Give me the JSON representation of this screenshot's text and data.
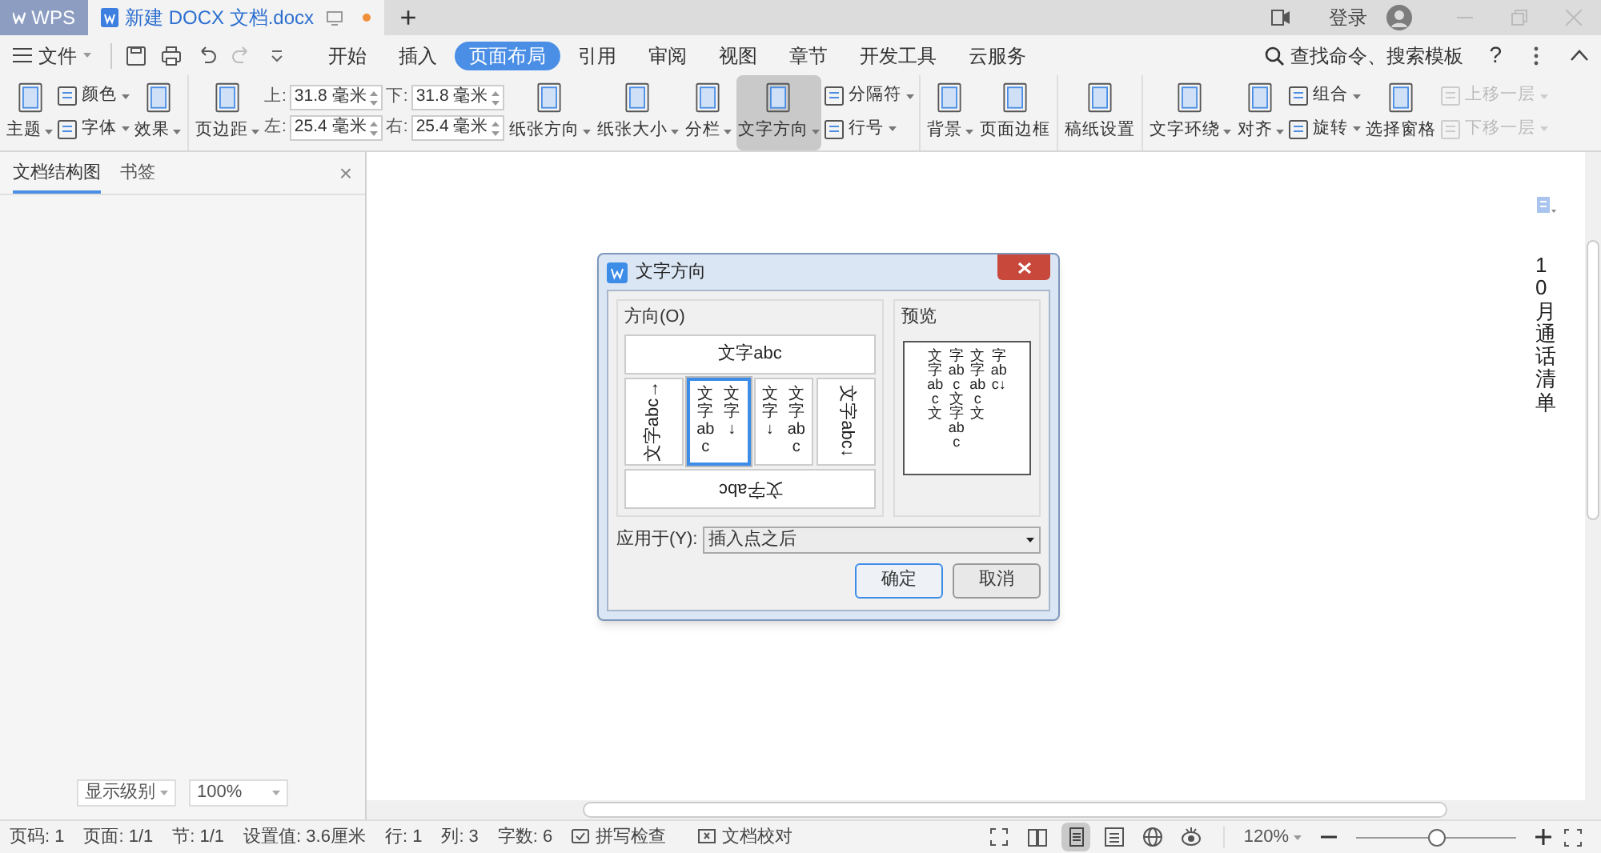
{
  "titlebar": {
    "app": "WPS",
    "document_tab": "新建 DOCX 文档.docx",
    "new_tab": "+",
    "login": "登录"
  },
  "menu": {
    "file": "文件",
    "tabs": [
      {
        "label": "开始",
        "selected": false
      },
      {
        "label": "插入",
        "selected": false
      },
      {
        "label": "页面布局",
        "selected": true
      },
      {
        "label": "引用",
        "selected": false
      },
      {
        "label": "审阅",
        "selected": false
      },
      {
        "label": "视图",
        "selected": false
      },
      {
        "label": "章节",
        "selected": false
      },
      {
        "label": "开发工具",
        "selected": false
      },
      {
        "label": "云服务",
        "selected": false
      }
    ],
    "search": "查找命令、搜索模板",
    "help": "?"
  },
  "ribbon": [
    [
      {
        "kind": "large",
        "label": "主题",
        "dropdown": true,
        "pressed": false
      },
      {
        "kind": "pair",
        "items": [
          {
            "label": "颜色",
            "dropdown": true,
            "disabled": false
          },
          {
            "label": "字体",
            "dropdown": true,
            "disabled": false
          }
        ]
      },
      {
        "kind": "large",
        "label": "效果",
        "dropdown": true,
        "pressed": false
      }
    ],
    [
      {
        "kind": "large",
        "label": "页边距",
        "dropdown": true,
        "pressed": false
      },
      {
        "kind": "spin",
        "items": [
          {
            "label": "上:",
            "value": "31.8 毫米"
          },
          {
            "label": "左:",
            "value": "25.4 毫米"
          }
        ]
      },
      {
        "kind": "spin",
        "items": [
          {
            "label": "下:",
            "value": "31.8 毫米"
          },
          {
            "label": "右:",
            "value": "25.4 毫米"
          }
        ]
      },
      {
        "kind": "large",
        "label": "纸张方向",
        "dropdown": true,
        "pressed": false
      },
      {
        "kind": "large",
        "label": "纸张大小",
        "dropdown": true,
        "pressed": false
      },
      {
        "kind": "large",
        "label": "分栏",
        "dropdown": true,
        "pressed": false
      },
      {
        "kind": "large",
        "label": "文字方向",
        "dropdown": true,
        "pressed": true
      },
      {
        "kind": "pair",
        "items": [
          {
            "label": "分隔符",
            "dropdown": true,
            "disabled": false
          },
          {
            "label": "行号",
            "dropdown": true,
            "disabled": false
          }
        ]
      }
    ],
    [
      {
        "kind": "large",
        "label": "背景",
        "dropdown": true,
        "pressed": false
      },
      {
        "kind": "large",
        "label": "页面边框",
        "dropdown": false,
        "pressed": false
      }
    ],
    [
      {
        "kind": "large",
        "label": "稿纸设置",
        "dropdown": false,
        "pressed": false
      }
    ],
    [
      {
        "kind": "large",
        "label": "文字环绕",
        "dropdown": true,
        "pressed": false
      },
      {
        "kind": "large",
        "label": "对齐",
        "dropdown": true,
        "pressed": false
      },
      {
        "kind": "pair",
        "items": [
          {
            "label": "组合",
            "dropdown": true,
            "disabled": false
          },
          {
            "label": "旋转",
            "dropdown": true,
            "disabled": false
          }
        ]
      },
      {
        "kind": "large",
        "label": "选择窗格",
        "dropdown": false,
        "pressed": false
      },
      {
        "kind": "pair",
        "items": [
          {
            "label": "上移一层",
            "dropdown": true,
            "disabled": true
          },
          {
            "label": "下移一层",
            "dropdown": true,
            "disabled": true
          }
        ]
      }
    ]
  ],
  "sidebar": {
    "tabs": [
      {
        "label": "文档结构图",
        "selected": true
      },
      {
        "label": "书签",
        "selected": false
      }
    ],
    "close": "×",
    "level_select": "显示级别",
    "zoom_select": "100%"
  },
  "page": {
    "text": "10 月通话清单"
  },
  "dialog": {
    "title": "文字方向",
    "direction_group": "方向(O)",
    "preview_group": "预览",
    "options": [
      {
        "kind": "horizontal",
        "lines": [
          "文字abc"
        ],
        "selected": false
      },
      {
        "kind": "rotate-ccw",
        "lines": [
          "文字abc→"
        ],
        "selected": false
      },
      {
        "kind": "columns",
        "lines": [
          "文字abc",
          "文字↓"
        ],
        "selected": true
      },
      {
        "kind": "columns",
        "lines": [
          "文字↓",
          "文字abc"
        ],
        "selected": false
      },
      {
        "kind": "rotate-cw",
        "lines": [
          "文字abc↓"
        ],
        "selected": false
      },
      {
        "kind": "rotate-180",
        "lines": [
          "文字abc"
        ],
        "selected": false
      }
    ],
    "preview_lines": [
      "文字abc文",
      "字abc文字abc",
      "文字abc文",
      "字abc↓"
    ],
    "apply_label": "应用于(Y):",
    "apply_value": "插入点之后",
    "ok": "确定",
    "cancel": "取消"
  },
  "status_bar": {
    "items": [
      "页码: 1",
      "页面: 1/1",
      "节: 1/1",
      "设置值: 3.6厘米",
      "行: 1",
      "列: 3",
      "字数: 6"
    ],
    "spell": "拼写检查",
    "proof": "文档校对",
    "zoom": "120%",
    "zoom_slider": {
      "level": 0.5
    }
  }
}
